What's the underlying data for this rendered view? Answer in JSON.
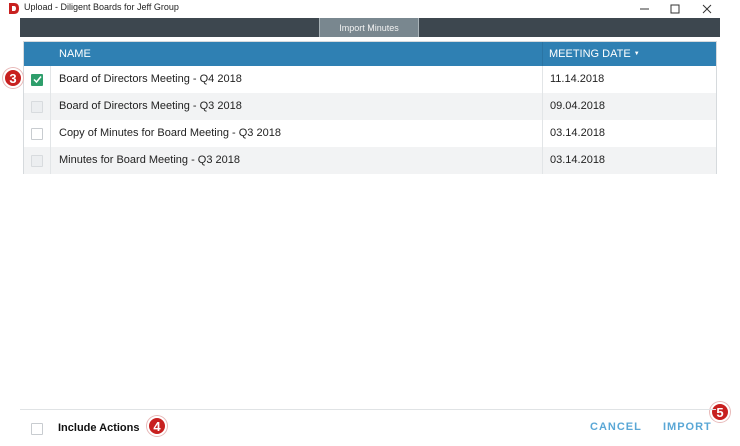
{
  "window": {
    "title": "Upload - Diligent Boards for Jeff Group",
    "logo_icon": "diligent-logo-icon",
    "brand_color": "#c8201f",
    "controls": [
      "minimize-icon",
      "maximize-icon",
      "close-icon"
    ]
  },
  "tabs": [
    {
      "label": "Import Minutes",
      "active": true
    }
  ],
  "table": {
    "header_color": "#2f80b3",
    "columns": {
      "name": "NAME",
      "date": "MEETING DATE",
      "sort_icon": "sort-down-icon"
    },
    "rows": [
      {
        "name": "Board of Directors Meeting - Q4 2018",
        "date": "11.14.2018",
        "checked": true,
        "disabled": false
      },
      {
        "name": "Board of Directors Meeting - Q3 2018",
        "date": "09.04.2018",
        "checked": false,
        "disabled": true
      },
      {
        "name": "Copy of Minutes for Board Meeting - Q3 2018",
        "date": "03.14.2018",
        "checked": false,
        "disabled": false
      },
      {
        "name": "Minutes for Board Meeting - Q3 2018",
        "date": "03.14.2018",
        "checked": false,
        "disabled": true
      }
    ]
  },
  "steps": {
    "step3": "3",
    "step4": "4",
    "step5": "5"
  },
  "footer": {
    "include_actions_label": "Include Actions",
    "include_actions_checked": false,
    "cancel_label": "CANCEL",
    "import_label": "IMPORT",
    "button_color": "#5aa7d6"
  }
}
